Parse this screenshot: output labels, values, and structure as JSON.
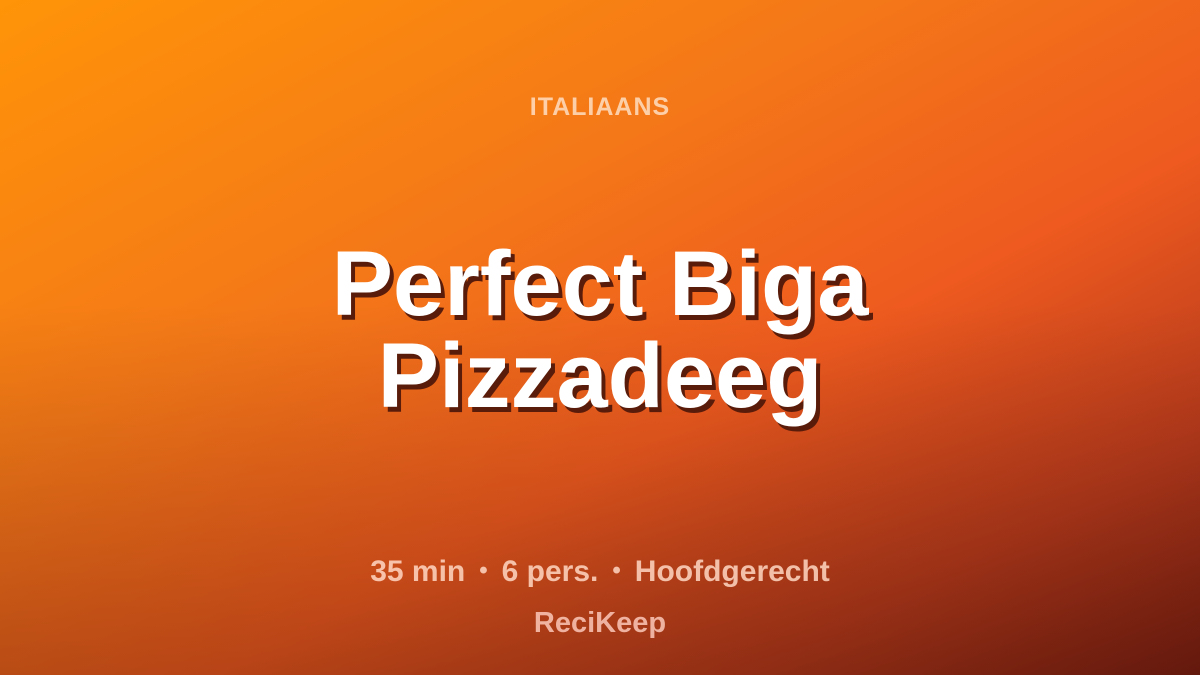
{
  "card": {
    "category": "ITALIAANS",
    "title_line1": "Perfect Biga",
    "title_line2": "Pizzadeeg",
    "meta": {
      "time": "35 min",
      "servings": "6 pers.",
      "course": "Hoofdgerecht",
      "separator": "•"
    },
    "brand": "ReciKeep"
  },
  "colors": {
    "gradient_start": "#ff9408",
    "gradient_mid": "#ee5a1f",
    "gradient_end": "#7a1e12",
    "title_text": "#ffffff",
    "title_shadow": "#5a1c0a"
  }
}
